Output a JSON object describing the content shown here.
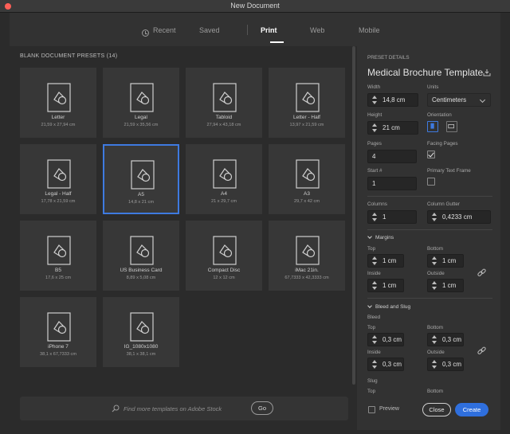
{
  "window": {
    "title": "New Document"
  },
  "tabs": [
    {
      "label": "Recent"
    },
    {
      "label": "Saved"
    },
    {
      "label": "Print"
    },
    {
      "label": "Web"
    },
    {
      "label": "Mobile"
    }
  ],
  "presets": {
    "header": "BLANK DOCUMENT PRESETS",
    "count": "(14)",
    "items": [
      {
        "name": "Letter",
        "size": "21,59 x 27,94 cm"
      },
      {
        "name": "Legal",
        "size": "21,59 x 35,56 cm"
      },
      {
        "name": "Tabloid",
        "size": "27,94 x 43,18 cm"
      },
      {
        "name": "Letter - Half",
        "size": "13,97 x 21,59 cm"
      },
      {
        "name": "Legal - Half",
        "size": "17,78 x 21,59 cm"
      },
      {
        "name": "A5",
        "size": "14,8 x 21 cm",
        "selected": true
      },
      {
        "name": "A4",
        "size": "21 x 29,7 cm"
      },
      {
        "name": "A3",
        "size": "29,7 x 42 cm"
      },
      {
        "name": "B5",
        "size": "17,6 x 25 cm"
      },
      {
        "name": "US Business Card",
        "size": "8,89 x 5,08 cm"
      },
      {
        "name": "Compact Disc",
        "size": "12 x 12 cm"
      },
      {
        "name": "iMac 21in.",
        "size": "67,7333 x 42,3333 cm"
      },
      {
        "name": "iPhone 7",
        "size": "38,1 x 67,7333 cm"
      },
      {
        "name": "IG_1080x1080",
        "size": "38,1 x 38,1 cm"
      }
    ]
  },
  "search": {
    "placeholder": "Find more templates on Adobe Stock",
    "go_label": "Go"
  },
  "details": {
    "header": "PRESET DETAILS",
    "preset_name": "Medical Brochure Template",
    "width_label": "Width",
    "width_value": "14,8 cm",
    "units_label": "Units",
    "units_value": "Centimeters",
    "height_label": "Height",
    "height_value": "21 cm",
    "orientation_label": "Orientation",
    "orientation_value": "portrait",
    "pages_label": "Pages",
    "pages_value": "4",
    "facing_pages_label": "Facing Pages",
    "facing_pages_checked": true,
    "start_label": "Start #",
    "start_value": "1",
    "primary_text_frame_label": "Primary Text Frame",
    "primary_text_frame_checked": false,
    "columns_label": "Columns",
    "columns_value": "1",
    "column_gutter_label": "Column Gutter",
    "column_gutter_value": "0,4233 cm",
    "margins": {
      "title": "Margins",
      "top_label": "Top",
      "top_value": "1 cm",
      "bottom_label": "Bottom",
      "bottom_value": "1 cm",
      "inside_label": "Inside",
      "inside_value": "1 cm",
      "outside_label": "Outside",
      "outside_value": "1 cm"
    },
    "bleed_slug": {
      "title": "Bleed and Slug",
      "bleed_label": "Bleed",
      "top_label": "Top",
      "top_value": "0,3 cm",
      "bottom_label": "Bottom",
      "bottom_value": "0,3 cm",
      "inside_label": "Inside",
      "inside_value": "0,3 cm",
      "outside_label": "Outside",
      "outside_value": "0,3 cm",
      "slug_label": "Slug",
      "slug_top_label": "Top",
      "slug_bottom_label": "Bottom"
    }
  },
  "footer": {
    "preview_label": "Preview",
    "close_label": "Close",
    "create_label": "Create"
  },
  "colors": {
    "accent": "#3e7ae0",
    "create_button": "#2f6fdd",
    "panel": "#323232",
    "background": "#2b2b2b"
  }
}
